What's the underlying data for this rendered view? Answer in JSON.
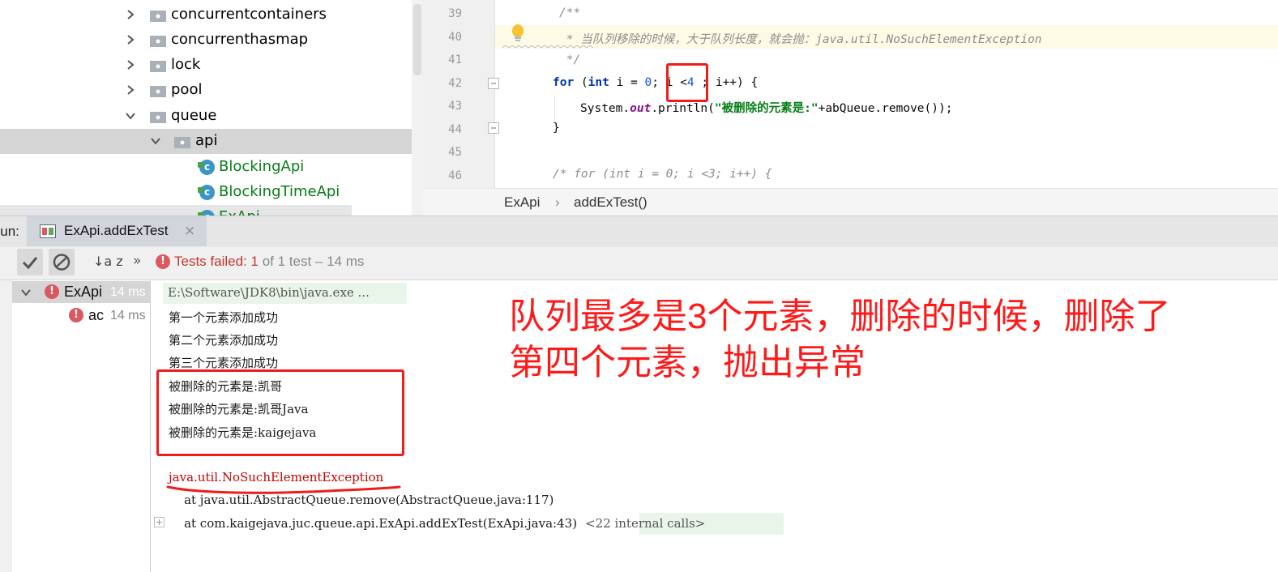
{
  "project_tree": {
    "items": [
      {
        "label": "concurrentcontainers",
        "expanded": false
      },
      {
        "label": "concurrenthasmap",
        "expanded": false
      },
      {
        "label": "lock",
        "expanded": false
      },
      {
        "label": "pool",
        "expanded": false
      },
      {
        "label": "queue",
        "expanded": true
      },
      {
        "label": "api",
        "expanded": true,
        "selected": true
      },
      {
        "label": "BlockingApi",
        "type": "class"
      },
      {
        "label": "BlockingTimeApi",
        "type": "class"
      },
      {
        "label": "ExApi",
        "type": "class"
      }
    ]
  },
  "editor": {
    "line_numbers": [
      "39",
      "40",
      "41",
      "42",
      "43",
      "44",
      "45",
      "46"
    ],
    "lines": {
      "l39": "/**",
      "l40": " * 当队列移除的时候，大于队列长度，就会抛：java.util.NoSuchElementException",
      "l41": " */",
      "l42_kw_for": "for",
      "l42_a": " (",
      "l42_kw_int": "int",
      "l42_b": " i = ",
      "l42_zero": "0",
      "l42_c": "; i <",
      "l42_four": "4",
      "l42_d": " ; i++) {",
      "l43_a": "System.",
      "l43_out": "out",
      "l43_b": ".println(",
      "l43_str": "\"被删除的元素是:\"",
      "l43_c": "+abQueue.remove());",
      "l44": "}",
      "l46": "/* for (int i = 0; i <3; i++) {"
    }
  },
  "breadcrumb": {
    "class_name": "ExApi",
    "separator": "›",
    "method_name": "addExTest()"
  },
  "run_panel": {
    "label": "Run:",
    "tab_label": "ExApi.addExTest",
    "tab_close": "×",
    "status_label": "Tests failed:",
    "status_count": "1",
    "status_rest": "of 1 test – 14 ms",
    "sort_label": "↓a z",
    "more": "»",
    "test_tree": [
      {
        "name": "ExApi",
        "time": "14 ms"
      },
      {
        "name": "ac",
        "time": "14 ms"
      }
    ]
  },
  "console": {
    "command": "E:\\Software\\JDK8\\bin\\java.exe ...",
    "output": [
      "第一个元素添加成功",
      "第二个元素添加成功",
      "第三个元素添加成功",
      "被删除的元素是:凯哥",
      "被删除的元素是:凯哥Java",
      "被删除的元素是:kaigejava"
    ],
    "exception": "java.util.NoSuchElementException",
    "stack1_prefix": "    at java.util.AbstractQueue.remove(",
    "stack1_link": "AbstractQueue.java:117",
    "stack1_suffix": ")",
    "stack2_prefix": "    at com.kaigejava.juc.queue.api.ExApi.addExTest(",
    "stack2_link": "ExApi.java:43",
    "stack2_suffix": ")",
    "internal_calls": "<22 internal calls>"
  },
  "annotation": {
    "line1": "队列最多是3个元素，删除的时候，删除了",
    "line2": "第四个元素，抛出异常",
    "color": "#ff1a1a"
  }
}
